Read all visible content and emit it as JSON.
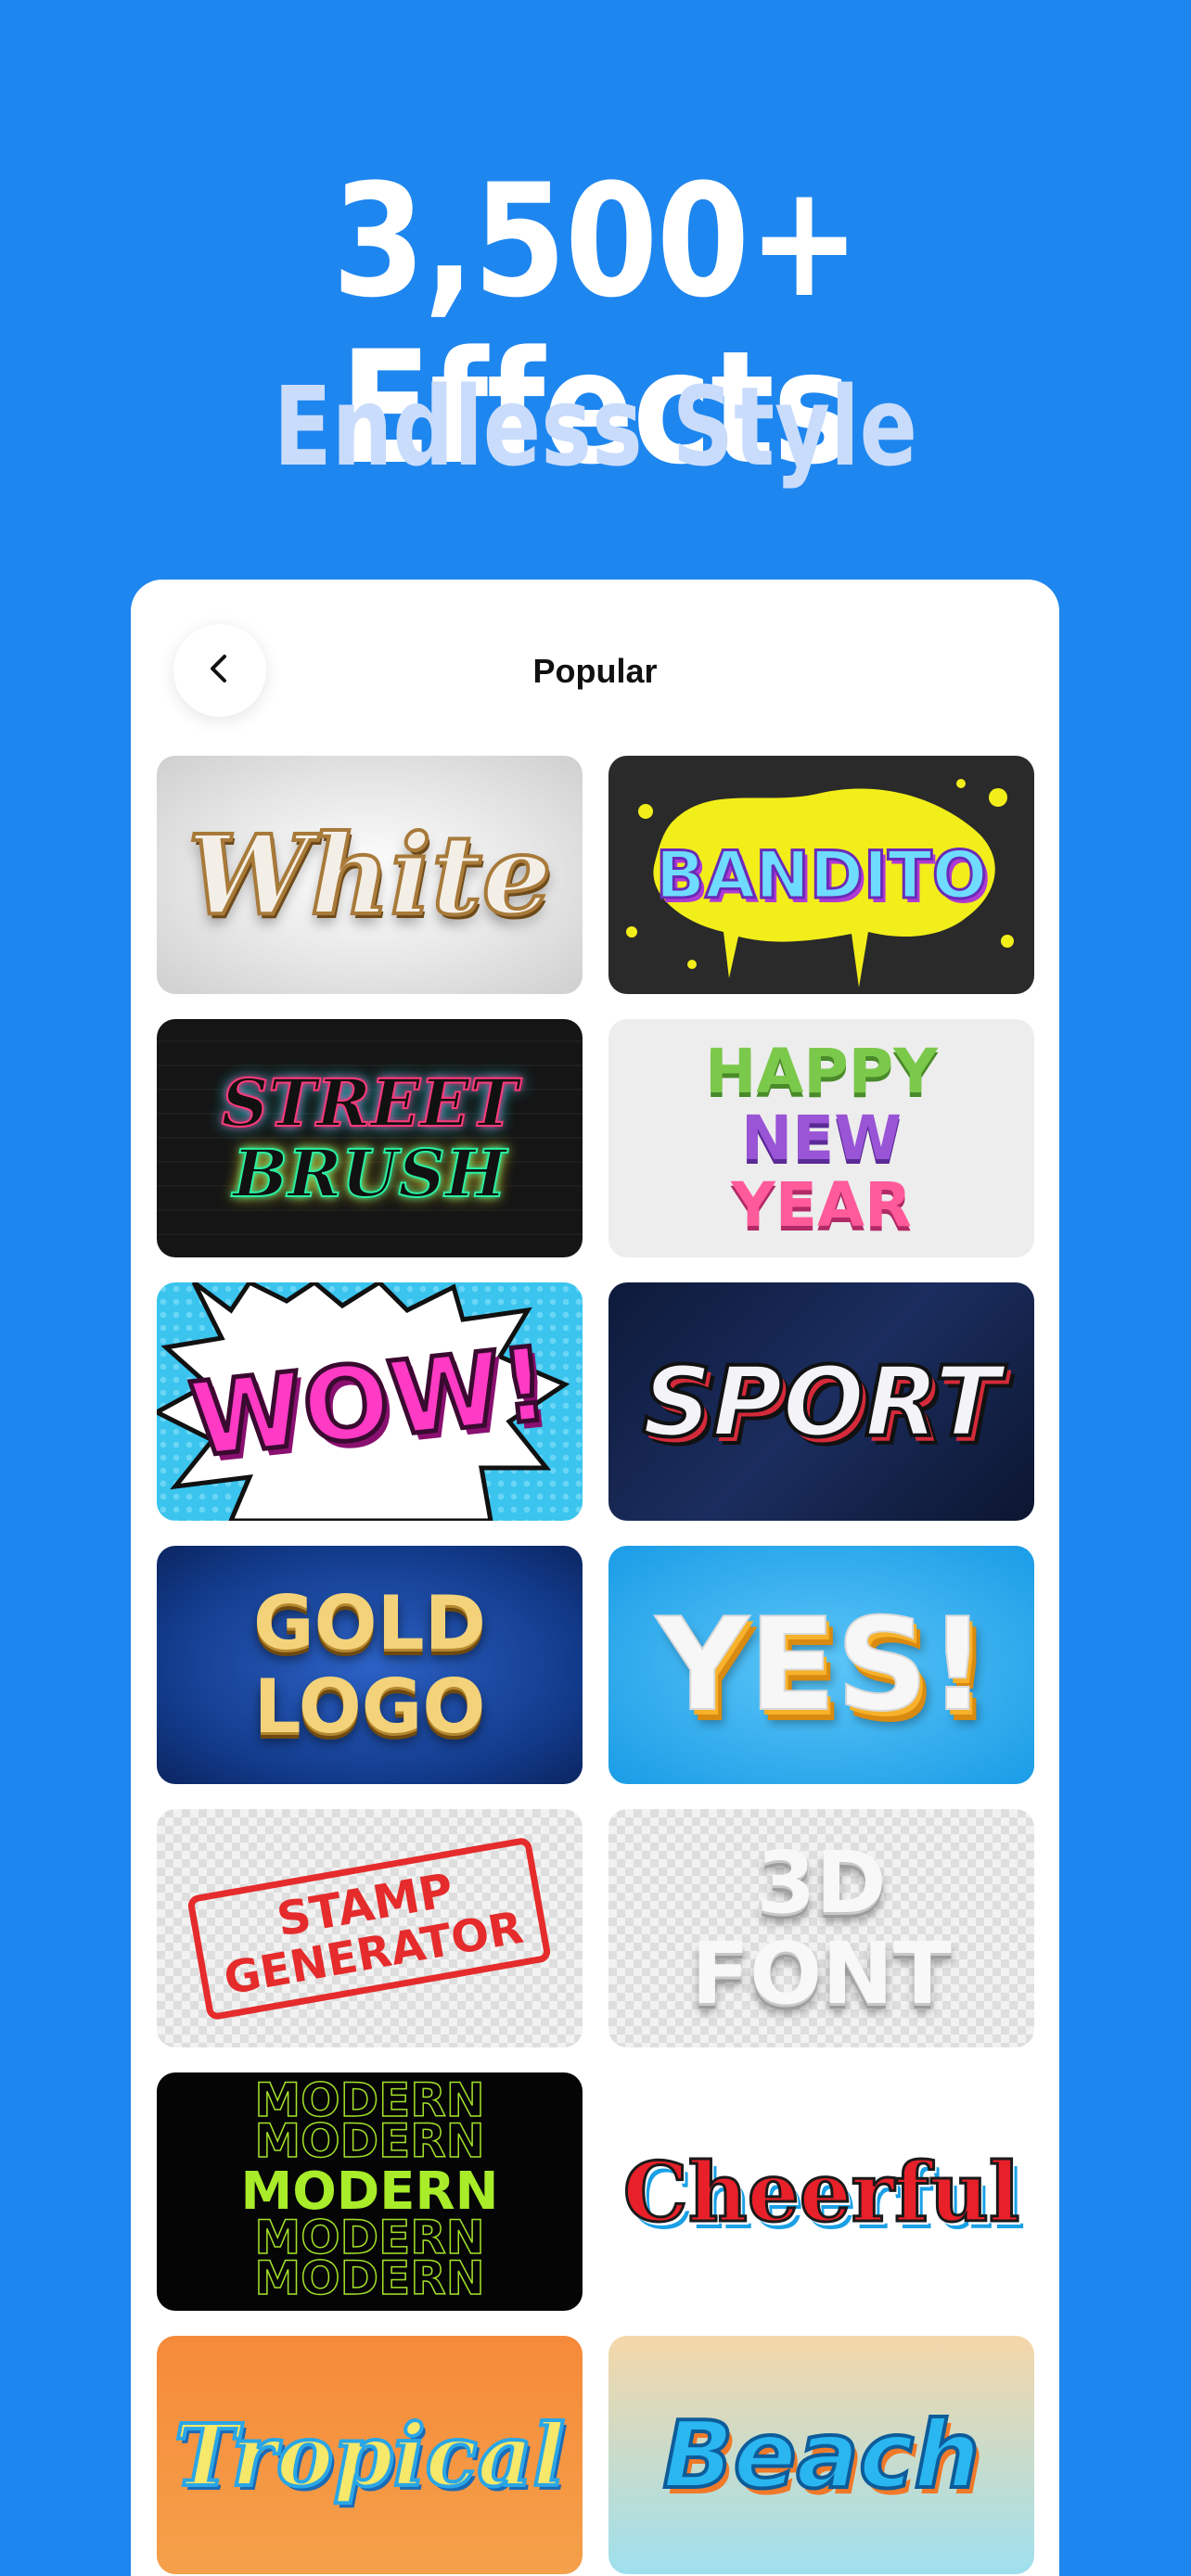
{
  "headline": "3,500+ Effects",
  "subheadline": "Endless Style",
  "screen": {
    "title": "Popular",
    "back_icon": "chevron-left-icon"
  },
  "effects": [
    {
      "label": "White"
    },
    {
      "label": "BANDITO"
    },
    {
      "label_line1": "STREET",
      "label_line2": "BRUSH"
    },
    {
      "label_line1": "HAPPY",
      "label_line2": "NEW",
      "label_line3": "YEAR"
    },
    {
      "label": "WOW!"
    },
    {
      "label": "SPORT"
    },
    {
      "label_line1": "GOLD",
      "label_line2": "LOGO"
    },
    {
      "label": "YES!"
    },
    {
      "label_line1": "STAMP",
      "label_line2": "GENERATOR"
    },
    {
      "label_line1": "3D",
      "label_line2": "FONT"
    },
    {
      "label": "MODERN"
    },
    {
      "label": "Cheerful"
    },
    {
      "label": "Tropical"
    },
    {
      "label": "Beach"
    }
  ],
  "colors": {
    "background": "#1e86ef",
    "headline": "#ffffff",
    "subheadline": "#c9dcfb",
    "card": "#ffffff"
  }
}
